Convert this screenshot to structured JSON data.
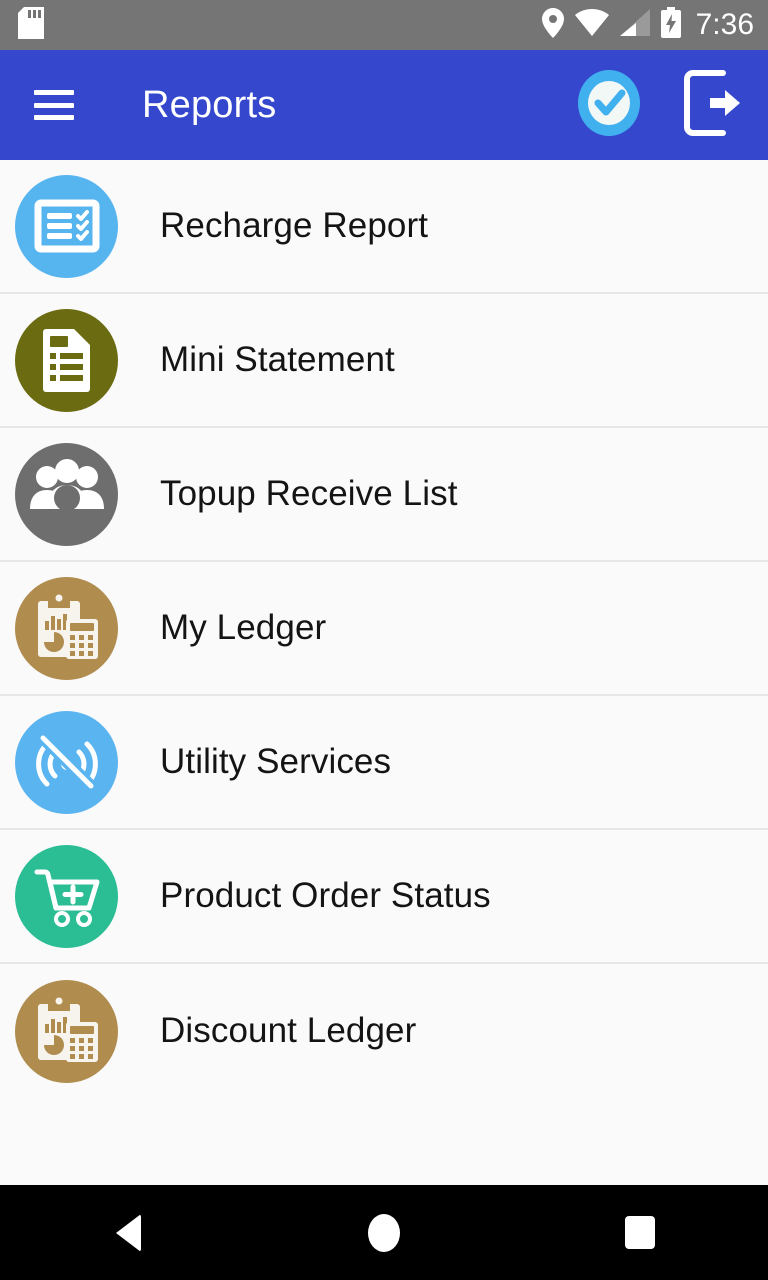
{
  "status_bar": {
    "background": "#757575",
    "time": "7:36",
    "left_icons": [
      "sd-card-icon"
    ],
    "right_icons": [
      "location-pin-icon",
      "wifi-icon",
      "cell-signal-icon",
      "battery-charging-icon"
    ]
  },
  "app_bar": {
    "background": "#3548cd",
    "title": "Reports",
    "menu_icon": "hamburger-menu-icon",
    "actions": [
      {
        "name": "verified-check-button",
        "icon": "check-circle-icon",
        "color": "#41b0ee"
      },
      {
        "name": "logout-button",
        "icon": "logout-icon",
        "color": "#ffffff"
      }
    ]
  },
  "list": {
    "background": "#fafafa",
    "divider_color": "#e6e6e6",
    "items": [
      {
        "label": "Recharge Report",
        "icon": "checklist-icon",
        "color": "#56b4ef"
      },
      {
        "label": "Mini Statement",
        "icon": "document-lines-icon",
        "color": "#6b6b11"
      },
      {
        "label": "Topup Receive List",
        "icon": "people-group-icon",
        "color": "#6e6e6e"
      },
      {
        "label": "My Ledger",
        "icon": "clipboard-calculator-icon",
        "color": "#b08d4f"
      },
      {
        "label": "Utility Services",
        "icon": "signal-off-icon",
        "color": "#5ab4f0"
      },
      {
        "label": "Product Order Status",
        "icon": "cart-plus-icon",
        "color": "#2bbd94"
      },
      {
        "label": "Discount Ledger",
        "icon": "clipboard-calculator-icon",
        "color": "#b08d4f"
      }
    ]
  },
  "nav_bar": {
    "background": "#000000",
    "buttons": [
      {
        "name": "nav-back-button",
        "icon": "triangle-back-icon"
      },
      {
        "name": "nav-home-button",
        "icon": "circle-home-icon"
      },
      {
        "name": "nav-recents-button",
        "icon": "square-recents-icon"
      }
    ]
  }
}
